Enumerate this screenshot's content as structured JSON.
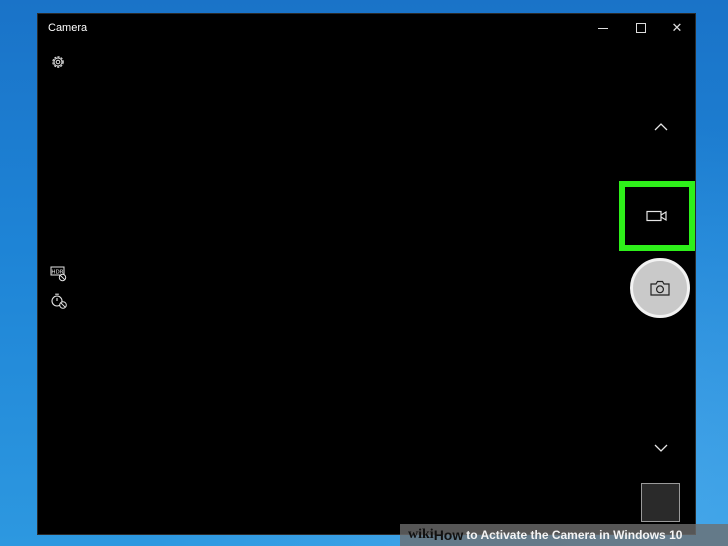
{
  "window": {
    "title": "Camera"
  },
  "controls": {
    "settings_icon": "gear-icon",
    "hdr_icon": "hdr-off-icon",
    "timer_icon": "timer-off-icon",
    "scroll_up_icon": "chevron-up-icon",
    "video_mode_icon": "video-camera-icon",
    "shutter_icon": "camera-icon",
    "scroll_down_icon": "chevron-down-icon"
  },
  "colors": {
    "highlight": "#2ef01a",
    "desktop": "#1e84d6"
  },
  "watermark": {
    "brand_wiki": "wiki",
    "brand_how": "How",
    "title": "to Activate the Camera in Windows 10"
  }
}
